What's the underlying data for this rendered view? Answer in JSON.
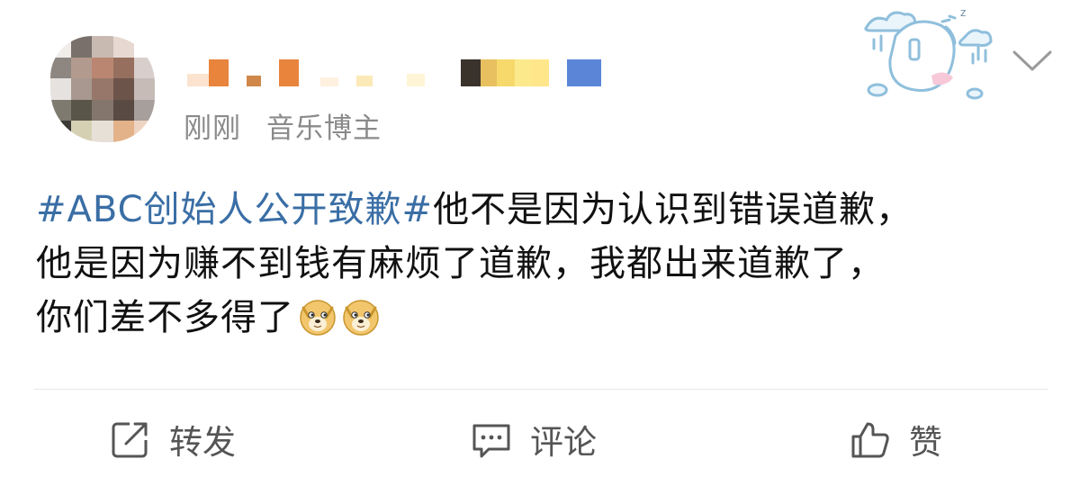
{
  "post": {
    "meta": {
      "time": "刚刚",
      "source": "音乐博主"
    },
    "content": {
      "topic": "#ABC创始人公开致歉#",
      "line1_rest": "他不是因为认识到错误道歉，",
      "line2": "他是因为赚不到钱有麻烦了道歉，我都出来道歉了，",
      "line3": "你们差不多得了"
    },
    "emoji": [
      "doge-emoji",
      "doge-emoji"
    ]
  },
  "actions": {
    "repost": "转发",
    "comment": "评论",
    "like": "赞"
  },
  "colors": {
    "topic": "#3a6ea5",
    "text": "#111111",
    "meta": "#8a8a8a",
    "action": "#555555",
    "divider": "#e8e8e8"
  }
}
